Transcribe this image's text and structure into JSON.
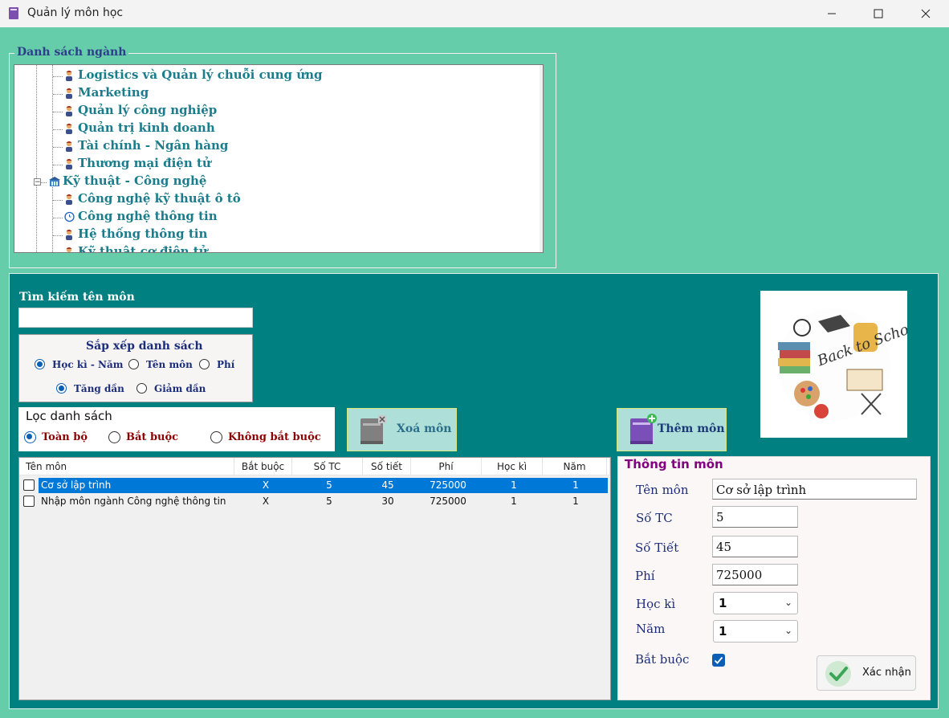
{
  "window": {
    "title": "Quản lý môn học",
    "icon": "book-icon"
  },
  "majors_group": {
    "title": "Danh sách ngành",
    "items": [
      {
        "label": "Logistics và Quản lý chuỗi cung ứng",
        "icon": "person-icon"
      },
      {
        "label": "Marketing",
        "icon": "person-icon"
      },
      {
        "label": "Quản lý công nghiệp",
        "icon": "person-icon"
      },
      {
        "label": "Quản trị kinh doanh",
        "icon": "person-icon"
      },
      {
        "label": "Tài chính - Ngân hàng",
        "icon": "person-icon"
      },
      {
        "label": "Thương mại điện tử",
        "icon": "person-icon"
      },
      {
        "label": "Kỹ thuật - Công nghệ",
        "icon": "building-icon"
      },
      {
        "label": "Công nghệ kỹ thuật ô tô",
        "icon": "person-icon"
      },
      {
        "label": "Công nghệ thông tin",
        "icon": "clock-icon"
      },
      {
        "label": "Hệ thống thông tin",
        "icon": "person-icon"
      },
      {
        "label": "Kỹ thuật cơ điện tử",
        "icon": "person-icon"
      }
    ]
  },
  "search": {
    "label": "Tìm kiếm tên môn",
    "value": ""
  },
  "sort": {
    "title": "Sắp xếp danh sách",
    "by_options": [
      "Học kì - Năm",
      "Tên môn",
      "Phí"
    ],
    "by_selected": "Học kì - Năm",
    "order_options": [
      "Tăng dần",
      "Giảm dần"
    ],
    "order_selected": "Tăng dần"
  },
  "filter": {
    "title": "Lọc danh sách",
    "options": [
      "Toàn bộ",
      "Bắt buộc",
      "Không bắt buộc"
    ],
    "selected": "Toàn bộ"
  },
  "buttons": {
    "delete": "Xoá môn",
    "add": "Thêm môn",
    "confirm": "Xác nhận"
  },
  "table": {
    "columns": [
      "Tên môn",
      "Bắt buộc",
      "Số TC",
      "Số tiết",
      "Phí",
      "Học kì",
      "Năm"
    ],
    "rows": [
      {
        "checked": false,
        "selected": true,
        "cells": [
          "Cơ sở lập trình",
          "X",
          "5",
          "45",
          "725000",
          "1",
          "1"
        ]
      },
      {
        "checked": false,
        "selected": false,
        "cells": [
          "Nhập môn ngành Công nghệ thông tin",
          "X",
          "5",
          "30",
          "725000",
          "1",
          "1"
        ]
      }
    ]
  },
  "info": {
    "title": "Thông tin môn",
    "labels": {
      "name": "Tên môn",
      "credits": "Số TC",
      "periods": "Số Tiết",
      "fee": "Phí",
      "semester": "Học kì",
      "year": "Năm",
      "required": "Bắt buộc"
    },
    "values": {
      "name": "Cơ sở lập trình",
      "credits": "5",
      "periods": "45",
      "fee": "725000",
      "semester": "1",
      "year": "1",
      "required": true
    }
  },
  "picture": {
    "caption": "Back to School"
  },
  "colors": {
    "background": "#66cdaa",
    "panel": "#008080",
    "selection": "#0078d7"
  }
}
